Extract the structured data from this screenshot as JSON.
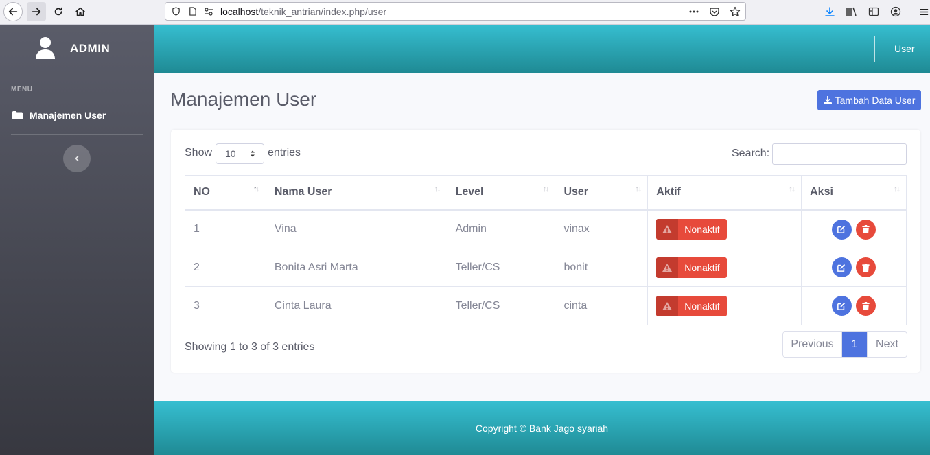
{
  "browser": {
    "url_host": "localhost",
    "url_path": "/teknik_antrian/index.php/user"
  },
  "sidebar": {
    "brand": "ADMIN",
    "heading": "MENU",
    "items": [
      {
        "label": "Manajemen User",
        "icon": "folder-icon"
      }
    ]
  },
  "topbar": {
    "user_label": "User"
  },
  "page": {
    "title": "Manajemen User",
    "add_button": "Tambah Data User"
  },
  "table_controls": {
    "show_label": "Show",
    "length_value": "10",
    "entries_label": "entries",
    "search_label": "Search:",
    "search_value": ""
  },
  "table": {
    "columns": [
      "NO",
      "Nama User",
      "Level",
      "User",
      "Aktif",
      "Aksi"
    ],
    "rows": [
      {
        "no": "1",
        "nama": "Vina",
        "level": "Admin",
        "user": "vinax",
        "status": "Nonaktif"
      },
      {
        "no": "2",
        "nama": "Bonita Asri Marta",
        "level": "Teller/CS",
        "user": "bonit",
        "status": "Nonaktif"
      },
      {
        "no": "3",
        "nama": "Cinta Laura",
        "level": "Teller/CS",
        "user": "cinta",
        "status": "Nonaktif"
      }
    ]
  },
  "pagination": {
    "info": "Showing 1 to 3 of 3 entries",
    "previous": "Previous",
    "current": "1",
    "next": "Next"
  },
  "footer": {
    "text": "Copyright © Bank Jago syariah"
  },
  "colors": {
    "primary": "#4e73df",
    "danger": "#e74a3b",
    "topbar": "#36bed0",
    "sidebar": "#5a5c69"
  }
}
